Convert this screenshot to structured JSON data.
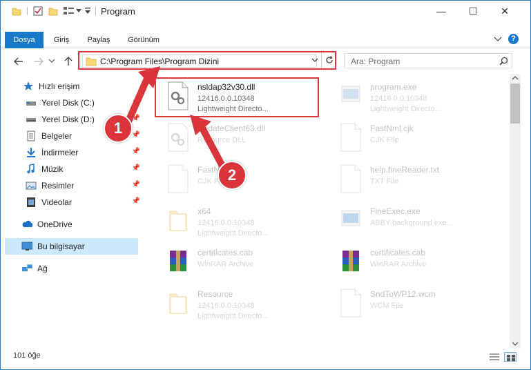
{
  "window": {
    "title": "Program",
    "minimize": "—",
    "maximize": "☐",
    "close": "✕"
  },
  "ribbon": {
    "tabs": [
      {
        "label": "Dosya"
      },
      {
        "label": "Giriş"
      },
      {
        "label": "Paylaş"
      },
      {
        "label": "Görünüm"
      }
    ],
    "help": "?"
  },
  "nav": {
    "address": "C:\\Program Files\\Program Dizini",
    "search_placeholder": "Ara: Program"
  },
  "sidebar": {
    "items": [
      {
        "label": "Hızlı erişim",
        "icon": "star-icon"
      },
      {
        "label": "Yerel Disk (C:)",
        "icon": "drive-icon"
      },
      {
        "label": "Yerel Disk (D:)",
        "icon": "drive-icon"
      },
      {
        "label": "Belgeler",
        "icon": "documents-icon"
      },
      {
        "label": "İndirmeler",
        "icon": "download-icon"
      },
      {
        "label": "Müzik",
        "icon": "music-icon"
      },
      {
        "label": "Resimler",
        "icon": "pictures-icon"
      },
      {
        "label": "Videolar",
        "icon": "video-icon"
      },
      {
        "label": "OneDrive",
        "icon": "cloud-icon"
      },
      {
        "label": "Bu bilgisayar",
        "icon": "computer-icon"
      },
      {
        "label": "Ağ",
        "icon": "network-icon"
      }
    ]
  },
  "files": [
    {
      "name": "nsldap32v30.dll",
      "line1": "12416.0.0.10348",
      "line2": "Lightweight Directo...",
      "icon": "dll-gear-icon"
    },
    {
      "name": "program.exe",
      "line1": "12416.0.0.10348",
      "line2": "Lightweight Directo...",
      "icon": "exe-icon"
    },
    {
      "name": "UpdateClient63.dll",
      "line1": "Resource DLL",
      "line2": "",
      "icon": "dll-gear-icon"
    },
    {
      "name": "FastNml.cjk",
      "line1": "CJK File",
      "line2": "",
      "icon": "blank-file-icon"
    },
    {
      "name": "FastNm...",
      "line1": "CJK File",
      "line2": "",
      "icon": "blank-file-icon"
    },
    {
      "name": "help.fineReader.txt",
      "line1": "TXT File",
      "line2": "",
      "icon": "text-file-icon"
    },
    {
      "name": "x64",
      "line1": "12416.0.0.10348",
      "line2": "Lightweight Directo...",
      "icon": "folder-icon"
    },
    {
      "name": "FineExec.exe",
      "line1": "ABBY background exe...",
      "line2": "",
      "icon": "exe-icon"
    },
    {
      "name": "certificates.cab",
      "line1": "WinRAR Archive",
      "line2": "",
      "icon": "winrar-icon"
    },
    {
      "name": "certificates.cab",
      "line1": "WinRAR Archive",
      "line2": "",
      "icon": "winrar-icon"
    },
    {
      "name": "Resource",
      "line1": "12416.0.0.10348",
      "line2": "Lightweight Directo...",
      "icon": "folder-icon"
    },
    {
      "name": "SndToWP12.wcm",
      "line1": "WCM File",
      "line2": "",
      "icon": "blank-file-icon"
    }
  ],
  "status": {
    "count": "101 öğe"
  },
  "markers": {
    "one": "1",
    "two": "2"
  },
  "colors": {
    "accent": "#1979ca",
    "highlight": "#e0393d",
    "selection": "#cce8ff"
  }
}
